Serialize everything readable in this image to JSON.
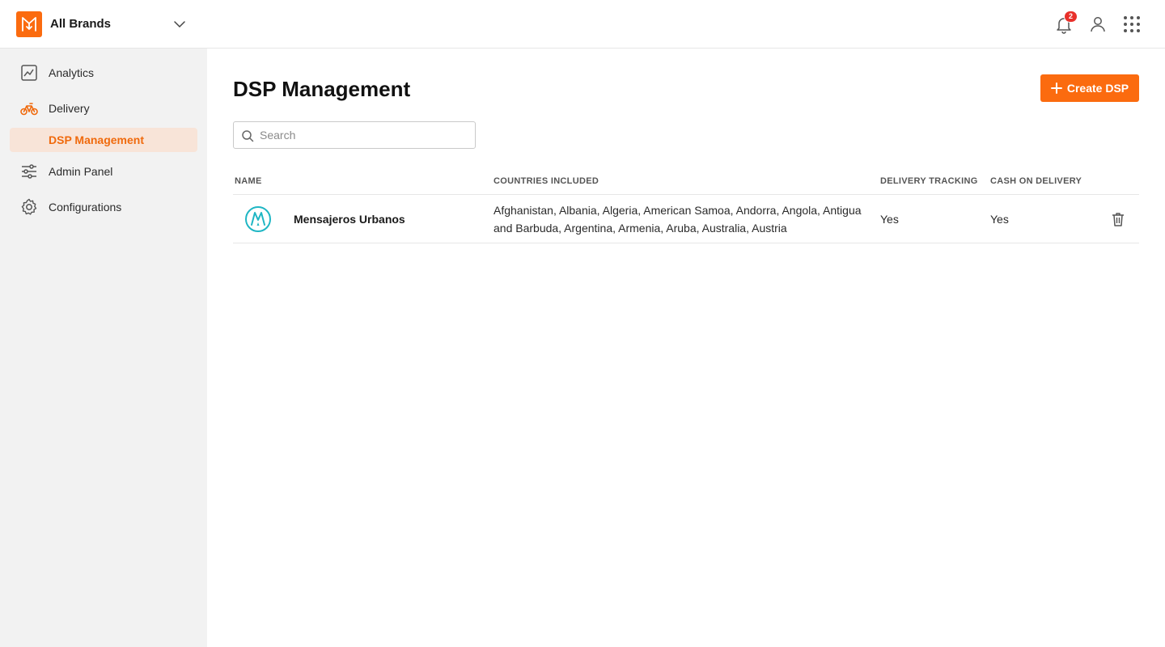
{
  "header": {
    "brand_selector": "All Brands",
    "notification_count": "2",
    "accent_color": "#fb6b0f"
  },
  "sidebar": {
    "items": [
      {
        "label": "Analytics",
        "icon": "analytics-chart-icon"
      },
      {
        "label": "Delivery",
        "icon": "bicycle-icon",
        "active": true
      },
      {
        "label": "DSP Management",
        "sub": true,
        "selected": true
      },
      {
        "label": "Admin Panel",
        "icon": "sliders-icon"
      },
      {
        "label": "Configurations",
        "icon": "gear-icon"
      }
    ]
  },
  "main": {
    "title": "DSP Management",
    "create_button": "Create DSP",
    "search_placeholder": "Search",
    "table": {
      "columns": [
        "NAME",
        "COUNTRIES INCLUDED",
        "DELIVERY TRACKING",
        "CASH ON DELIVERY"
      ],
      "rows": [
        {
          "name": "Mensajeros Urbanos",
          "countries": "Afghanistan, Albania, Algeria, American Samoa, Andorra, Angola, Antigua and Barbuda, Argentina, Armenia, Aruba, Australia, Austria",
          "delivery_tracking": "Yes",
          "cash_on_delivery": "Yes"
        }
      ]
    }
  }
}
